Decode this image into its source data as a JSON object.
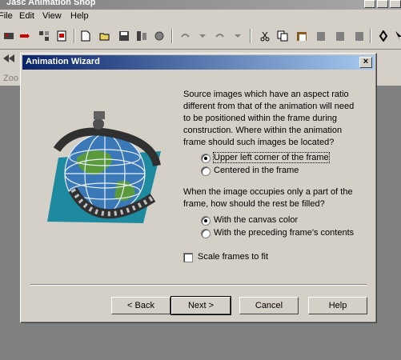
{
  "app": {
    "title": "Jasc Animation Shop"
  },
  "menu": {
    "items": [
      "File",
      "Edit",
      "View",
      "Help"
    ]
  },
  "toolbar": {
    "zoom_label": "Zoo"
  },
  "dialog": {
    "title": "Animation Wizard",
    "close": "×",
    "question1": "Source images which have an aspect ratio different from that of the animation will need to be positioned within the frame during construction.  Where within the animation frame should such images be located?",
    "options1": [
      "Upper left corner of the frame",
      "Centered in the frame"
    ],
    "question2": "When the image occupies only a part of the frame, how should the rest be filled?",
    "options2": [
      "With the canvas color",
      "With the preceding frame's contents"
    ],
    "checkbox": "Scale frames to fit",
    "buttons": {
      "back": "< Back",
      "next": "Next >",
      "cancel": "Cancel",
      "help": "Help"
    }
  }
}
